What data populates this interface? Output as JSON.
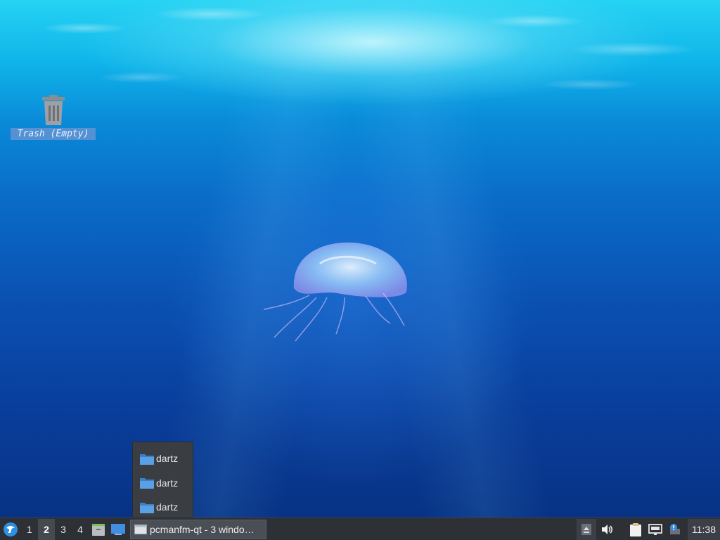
{
  "desktop": {
    "icons": [
      {
        "label": "Trash (Empty)",
        "icon": "trash-icon"
      }
    ]
  },
  "popup": {
    "items": [
      {
        "label": "dartz",
        "icon": "folder-icon"
      },
      {
        "label": "dartz",
        "icon": "folder-icon"
      },
      {
        "label": "dartz",
        "icon": "folder-icon"
      }
    ]
  },
  "taskbar": {
    "menu_icon": "lxqt-menu-icon",
    "workspaces": [
      "1",
      "2",
      "3",
      "4"
    ],
    "active_workspace": "2",
    "quicklaunch": [
      "file-manager-icon",
      "show-desktop-icon"
    ],
    "task_label": "pcmanfm-qt - 3 windo…",
    "tray": [
      "eject-icon",
      "volume-icon",
      "clipboard-icon",
      "network-icon",
      "notification-icon"
    ],
    "clock": "11:38"
  },
  "colors": {
    "panel_bg": "#2d3035",
    "folder_blue": "#4a90d9",
    "selection_bg": "#6e96d2"
  }
}
